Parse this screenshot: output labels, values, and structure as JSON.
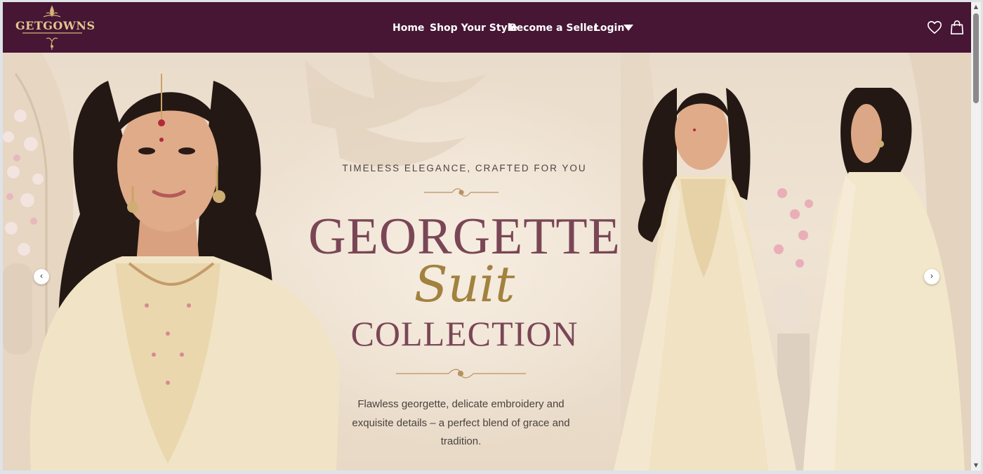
{
  "header": {
    "logo_text": "GETGOWNS",
    "nav": [
      "Home",
      "Shop Your Style",
      "Become a Seller",
      "Login"
    ],
    "icons": {
      "wishlist": "heart-icon",
      "cart": "shopping-bag-icon",
      "login_menu": "caret-down-icon"
    }
  },
  "hero": {
    "tagline": "TIMELESS ELEGANCE, CRAFTED FOR YOU",
    "title_line1": "GEORGETTE",
    "title_line2": "Suit",
    "title_line3": "COLLECTION",
    "description": "Flawless georgette, delicate embroidery and exquisite details – a perfect blend of grace and tradition.",
    "prev_arrow": "‹",
    "next_arrow": "›"
  },
  "colors": {
    "header_bg": "#461634",
    "title_plum": "#7a4656",
    "title_gold": "#a1823e",
    "hero_bg": "#efe3d3"
  }
}
